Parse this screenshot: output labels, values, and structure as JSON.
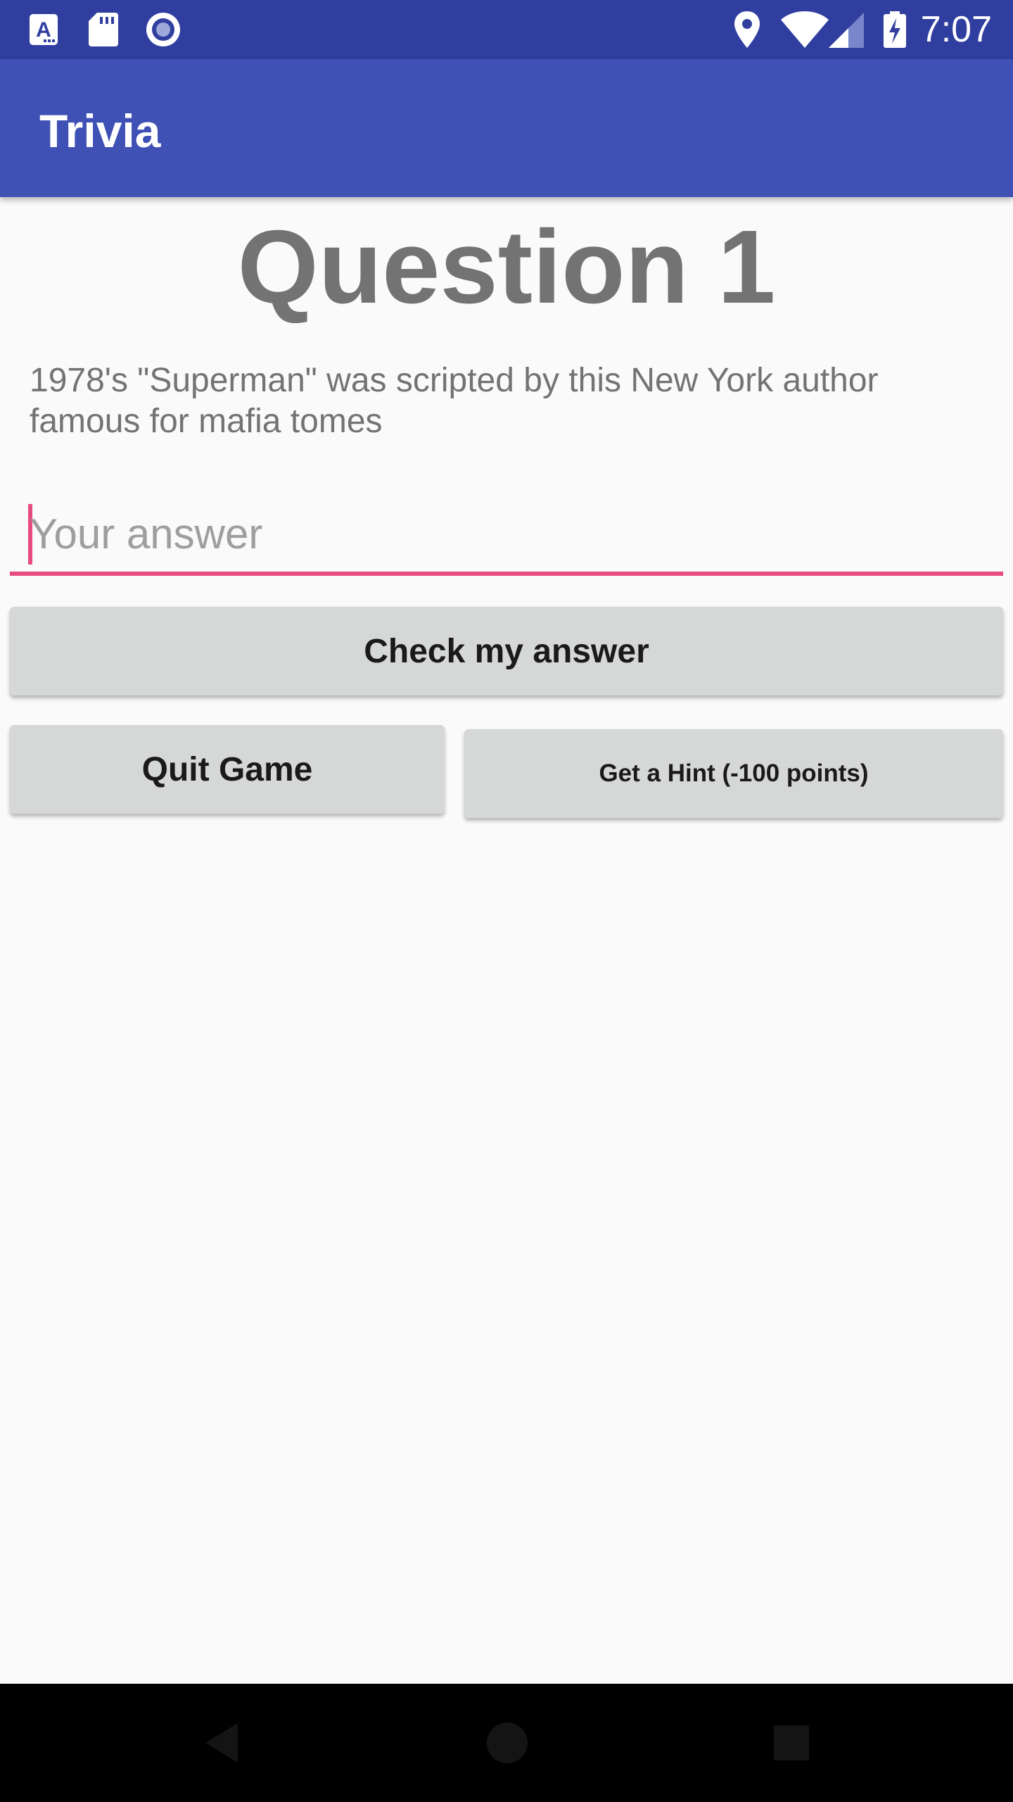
{
  "status_bar": {
    "time": "7:07",
    "left_icons": [
      "text-a-icon",
      "sd-card-icon",
      "radio-circle-icon"
    ],
    "right_icons": [
      "location-pin-icon",
      "wifi-icon",
      "cell-signal-icon",
      "battery-charging-icon"
    ],
    "background_color": "#303f9f"
  },
  "app_bar": {
    "title": "Trivia",
    "background_color": "#3f51b5"
  },
  "question": {
    "heading": "Question 1",
    "text": "1978's \"Superman\" was scripted by this New York author famous for mafia tomes"
  },
  "answer": {
    "placeholder": "Your answer",
    "value": "",
    "accent_color": "#e84b82"
  },
  "buttons": {
    "check_label": "Check my answer",
    "quit_label": "Quit Game",
    "hint_label": "Get a  Hint (-100 points)"
  },
  "nav_bar": {
    "items": [
      "back-icon",
      "home-icon",
      "recents-icon"
    ]
  }
}
